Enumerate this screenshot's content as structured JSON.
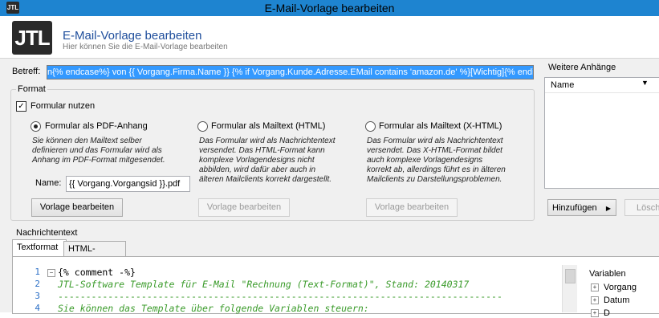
{
  "window": {
    "logo": "JTL",
    "title": "E-Mail-Vorlage bearbeiten"
  },
  "header": {
    "logo": "JTL",
    "title": "E-Mail-Vorlage bearbeiten",
    "subtitle": "Hier können Sie die E-Mail-Vorlage bearbeiten"
  },
  "subject": {
    "label": "Betreff:",
    "value": "n{% endcase%} von {{ Vorgang.Firma.Name }} {% if Vorgang.Kunde.Adresse.EMail contains 'amazon.de' %}[Wichtig]{% endif %}"
  },
  "format": {
    "group_label": "Format",
    "use_form_label": "Formular nutzen",
    "use_form_checked": true,
    "options": [
      {
        "label": "Formular als PDF-Anhang",
        "selected": true,
        "description": [
          "Sie können den Mailtext selber",
          "definieren und das Formular wird als",
          "Anhang im PDF-Format mitgesendet."
        ],
        "button": "Vorlage bearbeiten",
        "enabled": true
      },
      {
        "label": "Formular als Mailtext (HTML)",
        "selected": false,
        "description": [
          "Das Formular wird als Nachrichtentext",
          "versendet. Das HTML-Format kann",
          "komplexe Vorlagendesigns nicht",
          "abbilden, wird dafür aber auch in",
          "älteren Mailclients korrekt dargestellt."
        ],
        "button": "Vorlage bearbeiten",
        "enabled": false
      },
      {
        "label": "Formular als Mailtext (X-HTML)",
        "selected": false,
        "description": [
          "Das Formular wird als Nachrichtentext",
          "versendet. Das X-HTML-Format bildet",
          "auch komplexe Vorlagendesigns",
          "korrekt ab, allerdings führt es in älteren",
          "Mailclients zu Darstellungsproblemen."
        ],
        "button": "Vorlage bearbeiten",
        "enabled": false
      }
    ],
    "name_label": "Name:",
    "name_value": "{{ Vorgang.Vorgangsid }}.pdf"
  },
  "attachments": {
    "group_label": "Weitere Anhänge",
    "column": "Name",
    "add_button": "Hinzufügen",
    "delete_button": "Lösch"
  },
  "message": {
    "group_label": "Nachrichtentext",
    "tabs": [
      "Textformat",
      "HTML-Format"
    ],
    "active_tab": "Textformat",
    "lines": [
      {
        "num": "1",
        "text": "{% comment -%}"
      },
      {
        "num": "2",
        "text": "JTL-Software Template für E-Mail \"Rechnung (Text-Format)\", Stand: 20140317"
      },
      {
        "num": "3",
        "text": "--------------------------------------------------------------------------------"
      },
      {
        "num": "4",
        "text": "Sie können das Template über folgende Variablen steuern:"
      }
    ],
    "variables_label": "Variablen",
    "variables": [
      "Vorgang",
      "Datum",
      "D"
    ]
  }
}
